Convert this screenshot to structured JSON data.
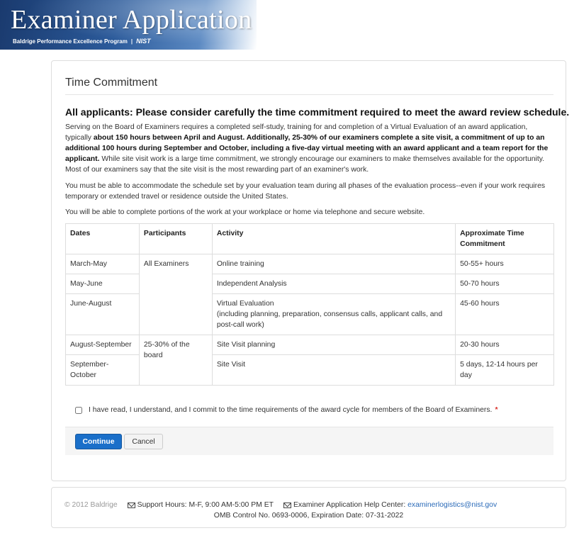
{
  "banner": {
    "title": "Examiner Application",
    "subtitle": "Baldrige Performance Excellence Program",
    "separator": "|",
    "agency": "NIST"
  },
  "panel": {
    "title": "Time Commitment",
    "heading": "All applicants: Please consider carefully the time commitment required to meet the award review schedule.",
    "p1_a": "Serving on the Board of Examiners requires a completed self-study, training for and completion of a Virtual Evaluation of an award application, typically ",
    "p1_b": "about 150 hours between April and August. Additionally, 25-30% of our examiners complete a site visit, a commitment of up to an additional 100 hours during September and October, including a five-day virtual meeting with an award applicant and a team report for the applicant.",
    "p1_c": " While site visit work is a large time commitment, we strongly encourage our examiners to make themselves available for the opportunity. Most of our examiners say that the site visit is the most rewarding part of an examiner's work.",
    "p2": "You must be able to accommodate the schedule set by your evaluation team during all phases of the evaluation process--even if your work requires temporary or extended travel or residence outside the United States.",
    "p3": "You will be able to complete portions of the work at your workplace or home via telephone and secure website."
  },
  "table": {
    "headers": [
      "Dates",
      "Participants",
      "Activity",
      "Approximate Time Commitment"
    ],
    "rows": [
      {
        "dates": "March-May",
        "activity": "Online training",
        "time": "50-55+ hours"
      },
      {
        "dates": "May-June",
        "activity": "Independent Analysis",
        "time": "50-70 hours"
      },
      {
        "dates": "June-August",
        "activity": "Virtual Evaluation",
        "activity_note": "(including planning, preparation, consensus calls, applicant calls, and post-call work)",
        "time": "45-60 hours"
      },
      {
        "dates": "August-September",
        "activity": "Site Visit planning",
        "time": "20-30 hours"
      },
      {
        "dates": "September-October",
        "activity": "Site Visit",
        "time": "5 days, 12-14 hours per day"
      }
    ],
    "participants_group1": "All Examiners",
    "participants_group2": "25-30% of the board"
  },
  "ack": {
    "label": "I have read, I understand, and I commit to the time requirements of the award cycle for members of the Board of Examiners.",
    "required": "*",
    "checked": false
  },
  "buttons": {
    "continue": "Continue",
    "cancel": "Cancel"
  },
  "footer": {
    "copyright": "© 2012 Baldrige",
    "support": "Support Hours: M-F, 9:00 AM-5:00 PM ET",
    "help_label": "Examiner Application Help Center:",
    "help_email": "examinerlogistics@nist.gov",
    "omb": "OMB Control No. 0693-0006, Expiration Date: 07-31-2022"
  },
  "colors": {
    "primary": "#1a6fc9",
    "link": "#2a6ab8",
    "required": "#d9312a"
  }
}
